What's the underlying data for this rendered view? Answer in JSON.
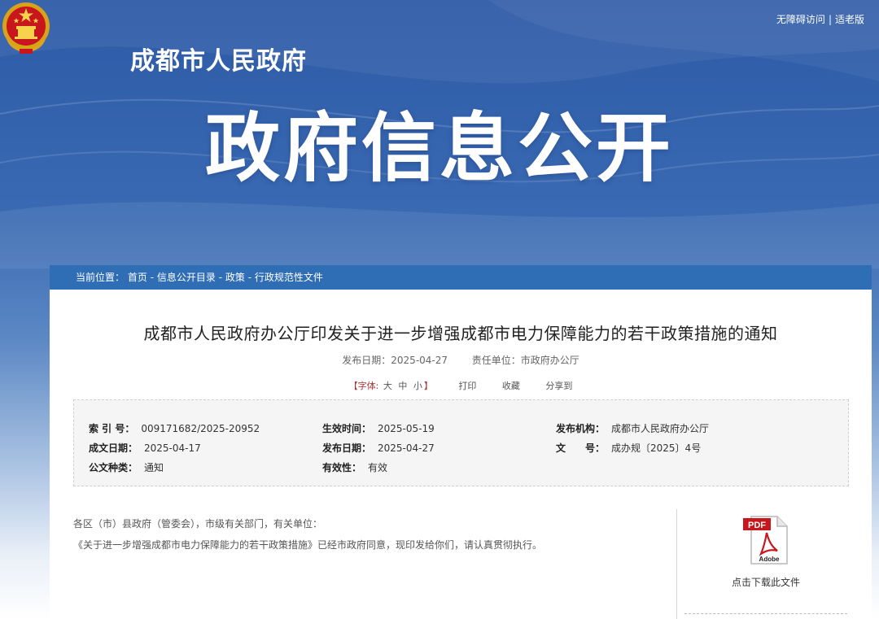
{
  "header": {
    "site_name": "成都市人民政府",
    "accessibility_link": "无障碍访问",
    "separator": "|",
    "elderly_link": "适老版",
    "banner_title": "政府信息公开"
  },
  "breadcrumb": {
    "prefix": "当前位置：",
    "items": [
      "首页",
      "信息公开目录",
      "政策",
      "行政规范性文件"
    ],
    "separator": " - "
  },
  "article": {
    "title": "成都市人民政府办公厅印发关于进一步增强成都市电力保障能力的若干政策措施的通知",
    "publish_date_label": "发布日期：",
    "publish_date": "2025-04-27",
    "unit_label": "责任单位：",
    "unit": "市政府办公厅"
  },
  "tools": {
    "font_label": "【字体:",
    "size_large": "大",
    "size_medium": "中",
    "size_small": "小",
    "font_close": "】",
    "print": "打印",
    "favorite": "收藏",
    "share": "分享到"
  },
  "info": {
    "index_label": "索 引 号：",
    "index_value": "009171682/2025-20952",
    "effective_label": "生效时间：",
    "effective_value": "2025-05-19",
    "issuer_label": "发布机构：",
    "issuer_value": "成都市人民政府办公厅",
    "written_label": "成文日期：",
    "written_value": "2025-04-17",
    "pubdate_label": "发布日期：",
    "pubdate_value": "2025-04-27",
    "docno_label": "文　　号：",
    "docno_value": "成办规〔2025〕4号",
    "type_label": "公文种类：",
    "type_value": "通知",
    "validity_label": "有效性：",
    "validity_value": "有效"
  },
  "content": {
    "para1": "各区（市）县政府（管委会），市级有关部门，有关单位：",
    "para2": "《关于进一步增强成都市电力保障能力的若干政策措施》已经市政府同意，现印发给你们，请认真贯彻执行。"
  },
  "download": {
    "label": "点击下载此文件",
    "pdf_badge": "PDF",
    "pdf_brand": "Adobe"
  }
}
